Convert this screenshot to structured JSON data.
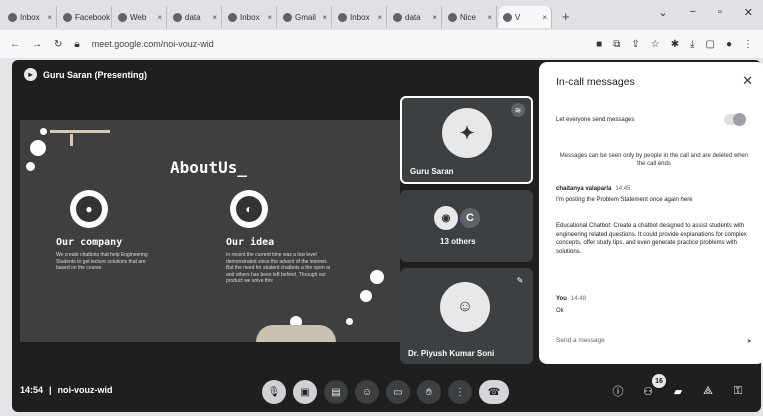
{
  "browser": {
    "tabs": [
      {
        "label": "Inbox"
      },
      {
        "label": "Facebook"
      },
      {
        "label": "Web"
      },
      {
        "label": "data"
      },
      {
        "label": "Inbox"
      },
      {
        "label": "Gmail"
      },
      {
        "label": "Inbox"
      },
      {
        "label": "data"
      },
      {
        "label": "Nice"
      },
      {
        "label": "V"
      }
    ],
    "url": "meet.google.com/noi-vouz-wid"
  },
  "meeting": {
    "presenter_label": "Guru Saran (Presenting)",
    "time": "14:54",
    "code": "noi-vouz-wid",
    "participants_badge": "16"
  },
  "slide": {
    "title": "AboutUs_",
    "company_heading": "Our company",
    "company_text": "We create chatbots that help Engineering Students to get lecture solutions that are based on the course",
    "idea_heading": "Our idea",
    "idea_text": "In recent the current time was a low level demonstrated since the advent of the internet. But the need for student chatbots a the open ai and others has been left behind. Through our product we solve this"
  },
  "tiles": {
    "speaker_name": "Guru Saran",
    "others_initial": "C",
    "others_label": "13 others",
    "third_name": "Dr. Piyush Kumar Soni"
  },
  "chat": {
    "title": "In-call messages",
    "toggle_label": "Let everyone send messages",
    "notice": "Messages can be seen only by people in the call and are deleted when the call ends",
    "messages": [
      {
        "sender": "chaitanya valaparla",
        "time": "14:45",
        "text": "I'm posting the Problem Statement once again here"
      },
      {
        "sender": "",
        "time": "",
        "text": "Educational Chatbot: Create a chatbot designed to assist students with engineering related questions. It could provide explanations for complex concepts, offer study tips, and even generate practice problems with solutions."
      },
      {
        "sender": "You",
        "time": "14:48",
        "text": "Ok"
      }
    ],
    "send_placeholder": "Send a message"
  }
}
